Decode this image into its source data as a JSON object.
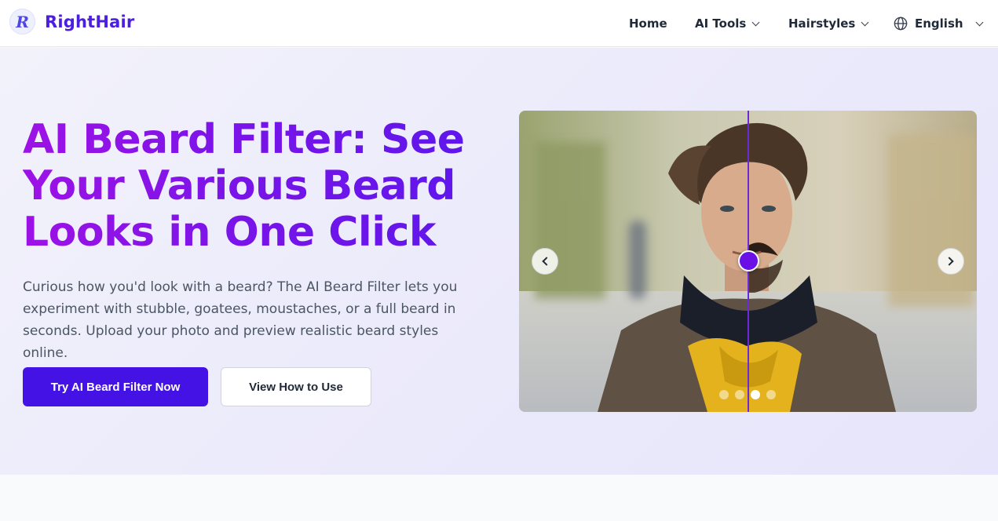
{
  "brand": {
    "name": "RightHair",
    "logo_letter": "R"
  },
  "nav": {
    "home": "Home",
    "ai_tools": "AI Tools",
    "hairstyles": "Hairstyles",
    "language": "English"
  },
  "hero": {
    "title": "AI Beard Filter: See Your Various Beard Looks in One Click",
    "description": "Curious how you'd look with a beard? The AI Beard Filter lets you experiment with stubble, goatees, moustaches, or a full beard in seconds. Upload your photo and preview realistic beard styles online.",
    "primary_cta": "Try AI Beard Filter Now",
    "secondary_cta": "View How to Use"
  },
  "carousel": {
    "slide_count": 4,
    "active_slide": 3
  },
  "colors": {
    "brand": "#4c1ee0",
    "primary_button": "#4512e6",
    "title_gradient_start": "#9d12e6",
    "title_gradient_end": "#5b16ec",
    "slider_handle": "#6a0fe6"
  }
}
